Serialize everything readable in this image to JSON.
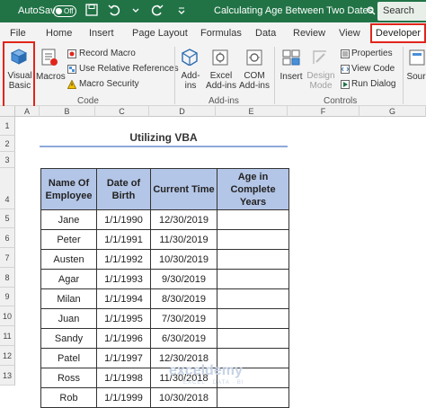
{
  "titlebar": {
    "autosave_label": "AutoSave",
    "autosave_state": "Off",
    "title": "Calculating Age Between Two Dates",
    "search_label": "Search"
  },
  "tabs": [
    "File",
    "Home",
    "Insert",
    "Page Layout",
    "Formulas",
    "Data",
    "Review",
    "View",
    "Developer"
  ],
  "ribbon": {
    "visual_basic": [
      "Visual",
      "Basic"
    ],
    "macros": "Macros",
    "record_macro": "Record Macro",
    "use_relative": "Use Relative References",
    "macro_security": "Macro Security",
    "code_group": "Code",
    "addins": [
      "Add-",
      "ins"
    ],
    "excel_addins": [
      "Excel",
      "Add-ins"
    ],
    "com_addins": [
      "COM",
      "Add-ins"
    ],
    "addins_group": "Add-ins",
    "insert": "Insert",
    "design_mode": [
      "Design",
      "Mode"
    ],
    "properties": "Properties",
    "view_code": "View Code",
    "run_dialog": "Run Dialog",
    "controls_group": "Controls",
    "source": "Sour"
  },
  "columns": [
    "A",
    "B",
    "C",
    "D",
    "E",
    "F",
    "G"
  ],
  "rows": [
    "1",
    "2",
    "3",
    "4",
    "5",
    "6",
    "7",
    "8",
    "9",
    "10",
    "11",
    "12",
    "13"
  ],
  "sheet": {
    "title": "Utilizing VBA",
    "headers": [
      [
        "Name Of",
        "Employee"
      ],
      [
        "Date of",
        "Birth"
      ],
      [
        "Current Time"
      ],
      [
        "Age in",
        "Complete",
        "Years"
      ]
    ],
    "data": [
      [
        "Jane",
        "1/1/1990",
        "12/30/2019",
        ""
      ],
      [
        "Peter",
        "1/1/1991",
        "11/30/2019",
        ""
      ],
      [
        "Austen",
        "1/1/1992",
        "10/30/2019",
        ""
      ],
      [
        "Agar",
        "1/1/1993",
        "9/30/2019",
        ""
      ],
      [
        "Milan",
        "1/1/1994",
        "8/30/2019",
        ""
      ],
      [
        "Juan",
        "1/1/1995",
        "7/30/2019",
        ""
      ],
      [
        "Sandy",
        "1/1/1996",
        "6/30/2019",
        ""
      ],
      [
        "Patel",
        "1/1/1997",
        "12/30/2018",
        ""
      ],
      [
        "Ross",
        "1/1/1998",
        "11/30/2018",
        ""
      ],
      [
        "Rob",
        "1/1/1999",
        "10/30/2018",
        ""
      ]
    ]
  },
  "watermark": {
    "brand": "exceldemy",
    "tag": "EXCEL · DATA · BI"
  }
}
